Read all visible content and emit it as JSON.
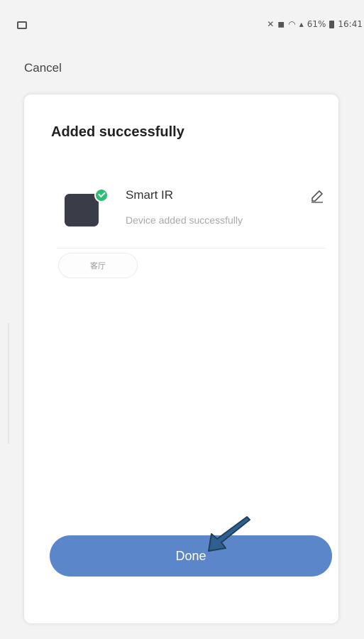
{
  "status_bar": {
    "left_icon": "image-icon",
    "mute_glyph": "✕",
    "alarm_glyph": "◼",
    "wifi_glyph": "◠",
    "signal_glyph": "▴",
    "battery_text": "61%",
    "time": "16:41"
  },
  "nav": {
    "cancel_label": "Cancel"
  },
  "card": {
    "title": "Added successfully",
    "device": {
      "name": "Smart IR",
      "status": "Device added successfully",
      "icon": "smart-ir-device-icon",
      "badge": "check-icon"
    },
    "room_chip_label": "客厅",
    "done_label": "Done"
  },
  "colors": {
    "accent": "#5b86c9",
    "success": "#2dbd73",
    "device_body": "#3a3d47",
    "annotation_arrow": "#2f5f8e"
  }
}
